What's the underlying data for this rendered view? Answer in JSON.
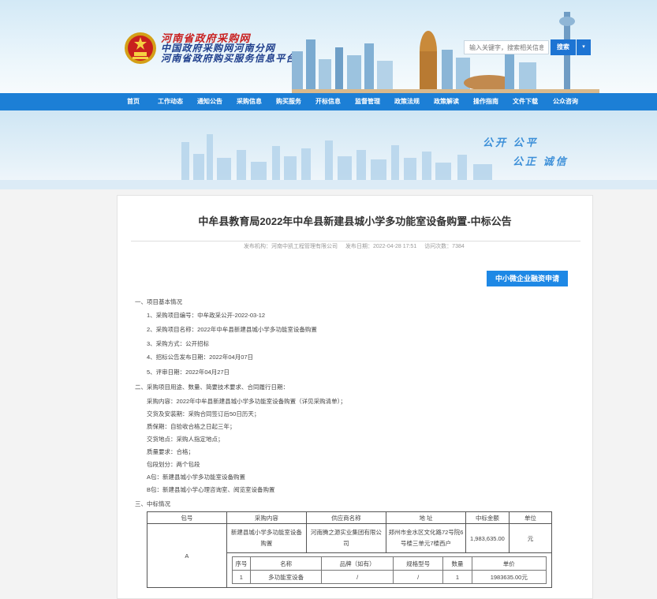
{
  "header": {
    "site_title_1": "河南省政府采购网",
    "site_title_2": "中国政府采购网河南分网",
    "site_title_3": "河南省政府购买服务信息平台",
    "search_placeholder": "输入关键字，搜索相关信息",
    "search_button": "搜索",
    "search_dropdown": "▾"
  },
  "nav": {
    "items": [
      "首页",
      "工作动态",
      "通知公告",
      "采购信息",
      "购买服务",
      "开标信息",
      "监督管理",
      "政策法规",
      "政策解读",
      "操作指南",
      "文件下载",
      "公众咨询"
    ]
  },
  "banner": {
    "slogan_1": "公开 公平",
    "slogan_2": "公正 诚信"
  },
  "article": {
    "title": "中牟县教育局2022年中牟县新建县城小学多功能室设备购置-中标公告",
    "publisher": "发布机构：河南中凯工程管理有限公司",
    "publish_date": "发布日期：2022-04-28 17:51",
    "visits": "访问次数：7384",
    "apply_button": "中小微企业融资申请",
    "lines": [
      "一、项目基本情况",
      "1、采购项目编号：中牟政采公开-2022-03-12",
      "2、采购项目名称：2022年中牟县新建县城小学多功能室设备购置",
      "3、采购方式：公开招标",
      "4、招标公告发布日期：2022年04月07日",
      "5、评审日期：2022年04月27日",
      "二、采购项目用途、数量、简要技术要求、合同履行日期：",
      "采购内容：2022年中牟县新建县城小学多功能室设备购置（详见采购清单）；",
      "交货及安装期：采购合同签订后50日历天；",
      "质保期：自验收合格之日起三年；",
      "交货地点：采购人指定地点；",
      "质量要求：合格；",
      "包段划分：两个包段",
      "A包：新建县城小学多功能室设备购置",
      "B包：新建县城小学心理咨询室、阅览室设备购置",
      "三、中标情况"
    ]
  },
  "table": {
    "headers": [
      "包号",
      "采购内容",
      "供应商名称",
      "地 址",
      "中标金额",
      "单位"
    ],
    "row": {
      "package": "A",
      "content": "新建县城小学多功能室设备购置",
      "supplier": "河南腾之源实业集团有限公司",
      "address": "郑州市金水区文化路72号院6号楼三单元7楼西户",
      "amount": "1,983,635.00",
      "unit": "元"
    },
    "sub_headers": [
      "序号",
      "名称",
      "品牌（如有）",
      "规格型号",
      "数量",
      "单价"
    ],
    "sub_row": [
      "1",
      "多功能室设备",
      "/",
      "/",
      "1",
      "1983635.00元"
    ]
  },
  "colors": {
    "nav_bg": "#1c7fd6",
    "accent_blue": "#1e88e5",
    "title_red": "#c81e1e"
  }
}
